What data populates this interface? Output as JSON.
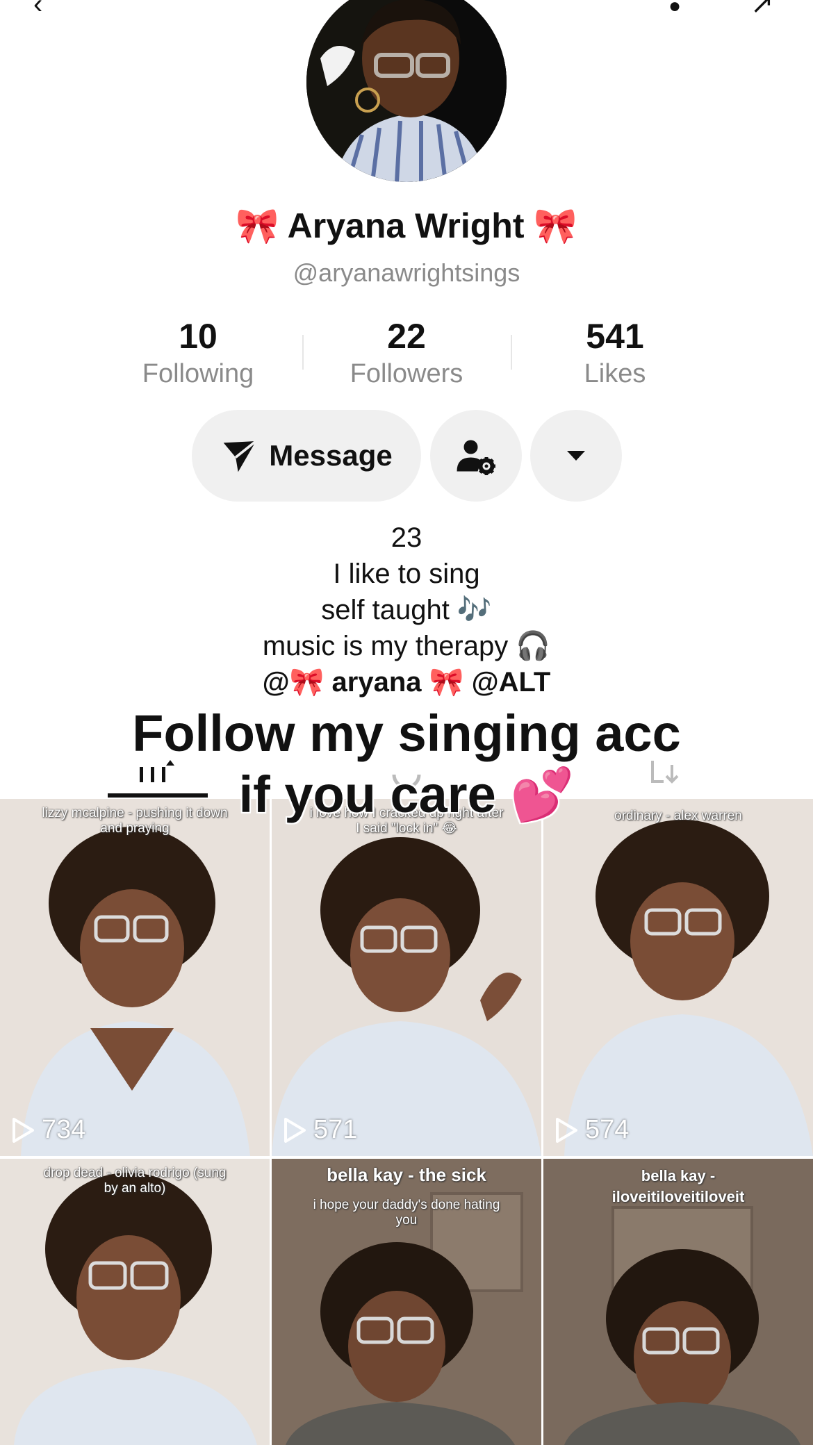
{
  "profile": {
    "display_name": "🎀 Aryana Wright 🎀",
    "handle": "@aryanawrightsings"
  },
  "stats": [
    {
      "value": "10",
      "label": "Following"
    },
    {
      "value": "22",
      "label": "Followers"
    },
    {
      "value": "541",
      "label": "Likes"
    }
  ],
  "actions": {
    "message_label": "Message"
  },
  "bio": {
    "lines": [
      "23",
      "I like to sing",
      "self taught 🎶",
      "music is my therapy 🎧"
    ],
    "links": "@🎀 aryana 🎀  @ALT"
  },
  "overlay_caption": "Follow my singing acc if you care 💕",
  "videos": [
    {
      "caption": "lizzy mcalpine - pushing it down and praying",
      "views": "734"
    },
    {
      "caption": "i love how I cracked up right after I said \"lock in\" 😂",
      "views": "571"
    },
    {
      "caption": "ordinary - alex warren",
      "views": "574"
    },
    {
      "caption": "drop dead - olivia rodrigo (sung by an alto)",
      "views": ""
    },
    {
      "caption": "bella kay - the sick",
      "subcaption": "i hope your daddy's done hating you",
      "views": ""
    },
    {
      "caption": "bella kay - iloveitiloveitiloveit",
      "views": ""
    }
  ],
  "icons": {
    "send": "paper-plane-icon",
    "friends": "person-gear-icon",
    "more": "caret-down-icon",
    "videos_tab": "grid-icon",
    "reposts_tab": "repost-icon",
    "liked_tab": "liked-icon"
  }
}
